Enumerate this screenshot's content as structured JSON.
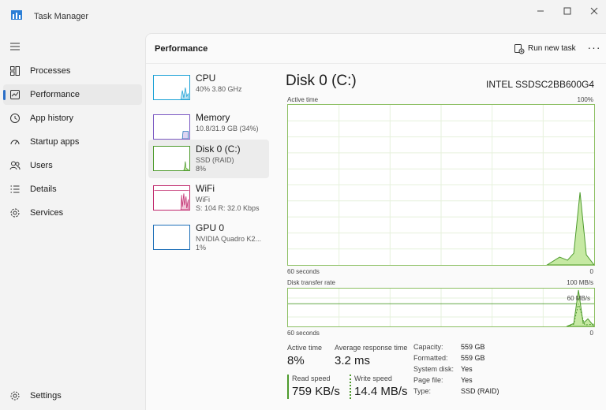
{
  "window": {
    "title": "Task Manager"
  },
  "nav": {
    "items": [
      {
        "label": "Processes",
        "icon": "processes-icon"
      },
      {
        "label": "Performance",
        "icon": "performance-icon",
        "active": true
      },
      {
        "label": "App history",
        "icon": "app-history-icon"
      },
      {
        "label": "Startup apps",
        "icon": "startup-apps-icon"
      },
      {
        "label": "Users",
        "icon": "users-icon"
      },
      {
        "label": "Details",
        "icon": "details-icon"
      },
      {
        "label": "Services",
        "icon": "services-icon"
      }
    ],
    "settings_label": "Settings"
  },
  "header": {
    "title": "Performance",
    "run_new_task": "Run new task",
    "more": "···"
  },
  "devices": [
    {
      "name": "CPU",
      "line1": "40% 3.80 GHz",
      "line2": "",
      "color": "#1aa1d6"
    },
    {
      "name": "Memory",
      "line1": "10.8/31.9 GB (34%)",
      "line2": "",
      "color": "#7a58c2"
    },
    {
      "name": "Disk 0 (C:)",
      "line1": "SSD (RAID)",
      "line2": "8%",
      "color": "#4d9a2c",
      "selected": true
    },
    {
      "name": "WiFi",
      "line1": "WiFi",
      "line2": "S: 104 R: 32.0 Kbps",
      "color": "#c0286c"
    },
    {
      "name": "GPU 0",
      "line1": "NVIDIA Quadro K2...",
      "line2": "1%",
      "color": "#1d6fb8"
    }
  ],
  "detail": {
    "title": "Disk 0 (C:)",
    "model": "INTEL SSDSC2BB600G4",
    "active_time_graph": {
      "label": "Active time",
      "max": "100%",
      "x_label": "60 seconds",
      "min": "0"
    },
    "transfer_graph": {
      "label": "Disk transfer rate",
      "max": "100 MB/s",
      "mid": "60 MB/s",
      "x_label": "60 seconds",
      "min": "0"
    },
    "stats": {
      "active_time_label": "Active time",
      "active_time": "8%",
      "avg_response_label": "Average response time",
      "avg_response": "3.2 ms",
      "read_speed_label": "Read speed",
      "read_speed": "759 KB/s",
      "write_speed_label": "Write speed",
      "write_speed": "14.4 MB/s"
    },
    "properties": [
      {
        "label": "Capacity:",
        "value": "559 GB"
      },
      {
        "label": "Formatted:",
        "value": "559 GB"
      },
      {
        "label": "System disk:",
        "value": "Yes"
      },
      {
        "label": "Page file:",
        "value": "Yes"
      },
      {
        "label": "Type:",
        "value": "SSD (RAID)"
      }
    ]
  },
  "colors": {
    "accent": "#2b6fc7",
    "disk_green": "#4d9a2c",
    "disk_fill": "#c6e9a3"
  }
}
